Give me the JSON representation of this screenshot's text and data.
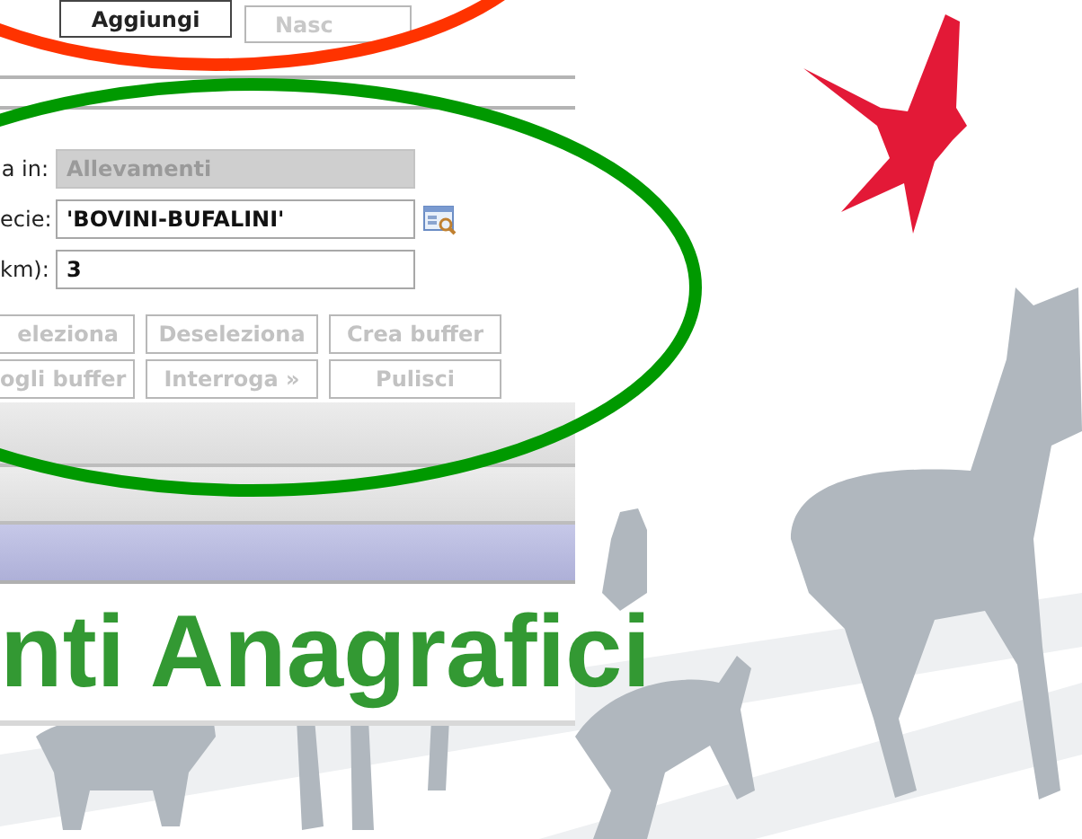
{
  "toolbar": {
    "buttons": [
      {
        "label": "Aggiungi",
        "disabled": false
      },
      {
        "label": "Nasc",
        "disabled": true
      }
    ]
  },
  "form": {
    "fields": [
      {
        "label": "a in:",
        "value": "Allevamenti",
        "disabled": true,
        "picker": false
      },
      {
        "label": "ecie:",
        "value": "'BOVINI-BUFALINI'",
        "disabled": false,
        "picker": true
      },
      {
        "label": "km):",
        "value": "3",
        "disabled": false,
        "picker": false
      }
    ],
    "actions": [
      {
        "label": "eleziona",
        "disabled": true
      },
      {
        "label": "Deseleziona",
        "disabled": true
      },
      {
        "label": "Crea buffer",
        "disabled": true
      },
      {
        "label": "ogli buffer",
        "disabled": true
      },
      {
        "label": "Interroga »",
        "disabled": true
      },
      {
        "label": "Pulisci",
        "disabled": true
      }
    ]
  },
  "title": "nti Anagrafici",
  "annotations": [
    {
      "color": "#ff3300"
    },
    {
      "color": "#009900"
    }
  ]
}
